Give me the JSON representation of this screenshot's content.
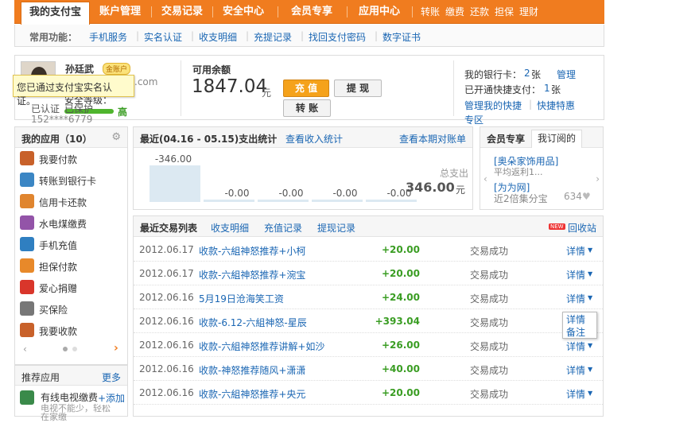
{
  "topnav": {
    "tabs": [
      "我的支付宝",
      "账户管理",
      "交易记录",
      "安全中心",
      "会员专享",
      "应用中心"
    ],
    "links": [
      "转账",
      "缴费",
      "还款",
      "担保",
      "理财"
    ]
  },
  "quick": {
    "label": "常用功能：",
    "items": [
      "手机服务",
      "实名认证",
      "收支明细",
      "充提记录",
      "找回支付密码",
      "数字证书"
    ]
  },
  "account": {
    "name": "孙廷武",
    "badge": "金账户",
    "email_partial": ".com",
    "security_level": "安全等级：",
    "security_value": "高",
    "verified": "已认证",
    "protected": "已保护",
    "phone": "152****6779",
    "tooltip": "您已通过支付宝实名认证。",
    "balance_label": "可用余额",
    "balance": "1847.04",
    "balance_unit": "元",
    "btn_recharge": "充 值",
    "btn_withdraw": "提 现",
    "btn_transfer": "转 账",
    "bank_label": "我的银行卡：",
    "bank_count": "2",
    "bank_unit": "张",
    "bank_manage": "管理",
    "quickpay_label": "已开通快捷支付：",
    "quickpay_count": "1",
    "quickpay_unit": "张",
    "manage_quick": "管理我的快捷",
    "quick_special": "快捷特惠",
    "special_zone": "专区"
  },
  "apps": {
    "title": "我的应用（10）",
    "items": [
      {
        "label": "我要付款",
        "color": "#c8612a"
      },
      {
        "label": "转账到银行卡",
        "color": "#3b86c4"
      },
      {
        "label": "信用卡还款",
        "color": "#e0852f"
      },
      {
        "label": "水电煤缴费",
        "color": "#9354a8"
      },
      {
        "label": "手机充值",
        "color": "#2f7fc1"
      },
      {
        "label": "担保付款",
        "color": "#e8892a"
      },
      {
        "label": "爱心捐赠",
        "color": "#d9362b"
      },
      {
        "label": "买保险",
        "color": "#777777"
      },
      {
        "label": "我要收款",
        "color": "#c8612a"
      }
    ],
    "recommend_title": "推荐应用",
    "more": "更多",
    "rec_item": "有线电视缴费",
    "rec_desc": "电视不能少，轻松",
    "rec_desc2": "在家缴",
    "add": "+添加"
  },
  "stats": {
    "title": "最近(04.16 - 05.15)支出统计",
    "link_income": "查看收入统计",
    "link_bill": "查看本期对账单",
    "total_label": "总支出",
    "total_value": "346.00",
    "total_unit": "元"
  },
  "chart_data": {
    "type": "bar",
    "values": [
      -346.0,
      -0.0,
      -0.0,
      -0.0,
      -0.0
    ],
    "labels": [
      "-346.00",
      "-0.00",
      "-0.00",
      "-0.00",
      "-0.00"
    ]
  },
  "member": {
    "title": "会员专享",
    "tab": "我订阅的",
    "item1": "[奥朵家饰用品]",
    "item1_desc": "平均返利1...",
    "item2": "[为为网]",
    "item2_desc": "近2倍集分宝",
    "likes": "634"
  },
  "tx": {
    "title": "最近交易列表",
    "tabs": [
      "收支明细",
      "充值记录",
      "提现记录"
    ],
    "recycle": "回收站",
    "new_badge": "NEW",
    "popup": [
      "详情",
      "备注"
    ],
    "rows": [
      {
        "date": "2012.06.17",
        "name": "收款-六組神怒推荐+小柯",
        "amount": "+20.00",
        "status": "交易成功",
        "action": "详情"
      },
      {
        "date": "2012.06.17",
        "name": "收款-六組神怒推荐+涴宝",
        "amount": "+20.00",
        "status": "交易成功",
        "action": "详情"
      },
      {
        "date": "2012.06.16",
        "name": "5月19日沧海笑工资",
        "amount": "+24.00",
        "status": "交易成功",
        "action": "详情"
      },
      {
        "date": "2012.06.16",
        "name": "收款-6.12-六組神怒-星辰",
        "amount": "+393.04",
        "status": "交易成功",
        "action": ""
      },
      {
        "date": "2012.06.16",
        "name": "收款-六組神怒推荐讲解+如沙",
        "amount": "+26.00",
        "status": "交易成功",
        "action": "详情"
      },
      {
        "date": "2012.06.16",
        "name": "收款-神怒推荐随风+潇潇",
        "amount": "+40.00",
        "status": "交易成功",
        "action": "详情"
      },
      {
        "date": "2012.06.16",
        "name": "收款-六組神怒推荐+央元",
        "amount": "+20.00",
        "status": "交易成功",
        "action": "详情"
      }
    ]
  }
}
